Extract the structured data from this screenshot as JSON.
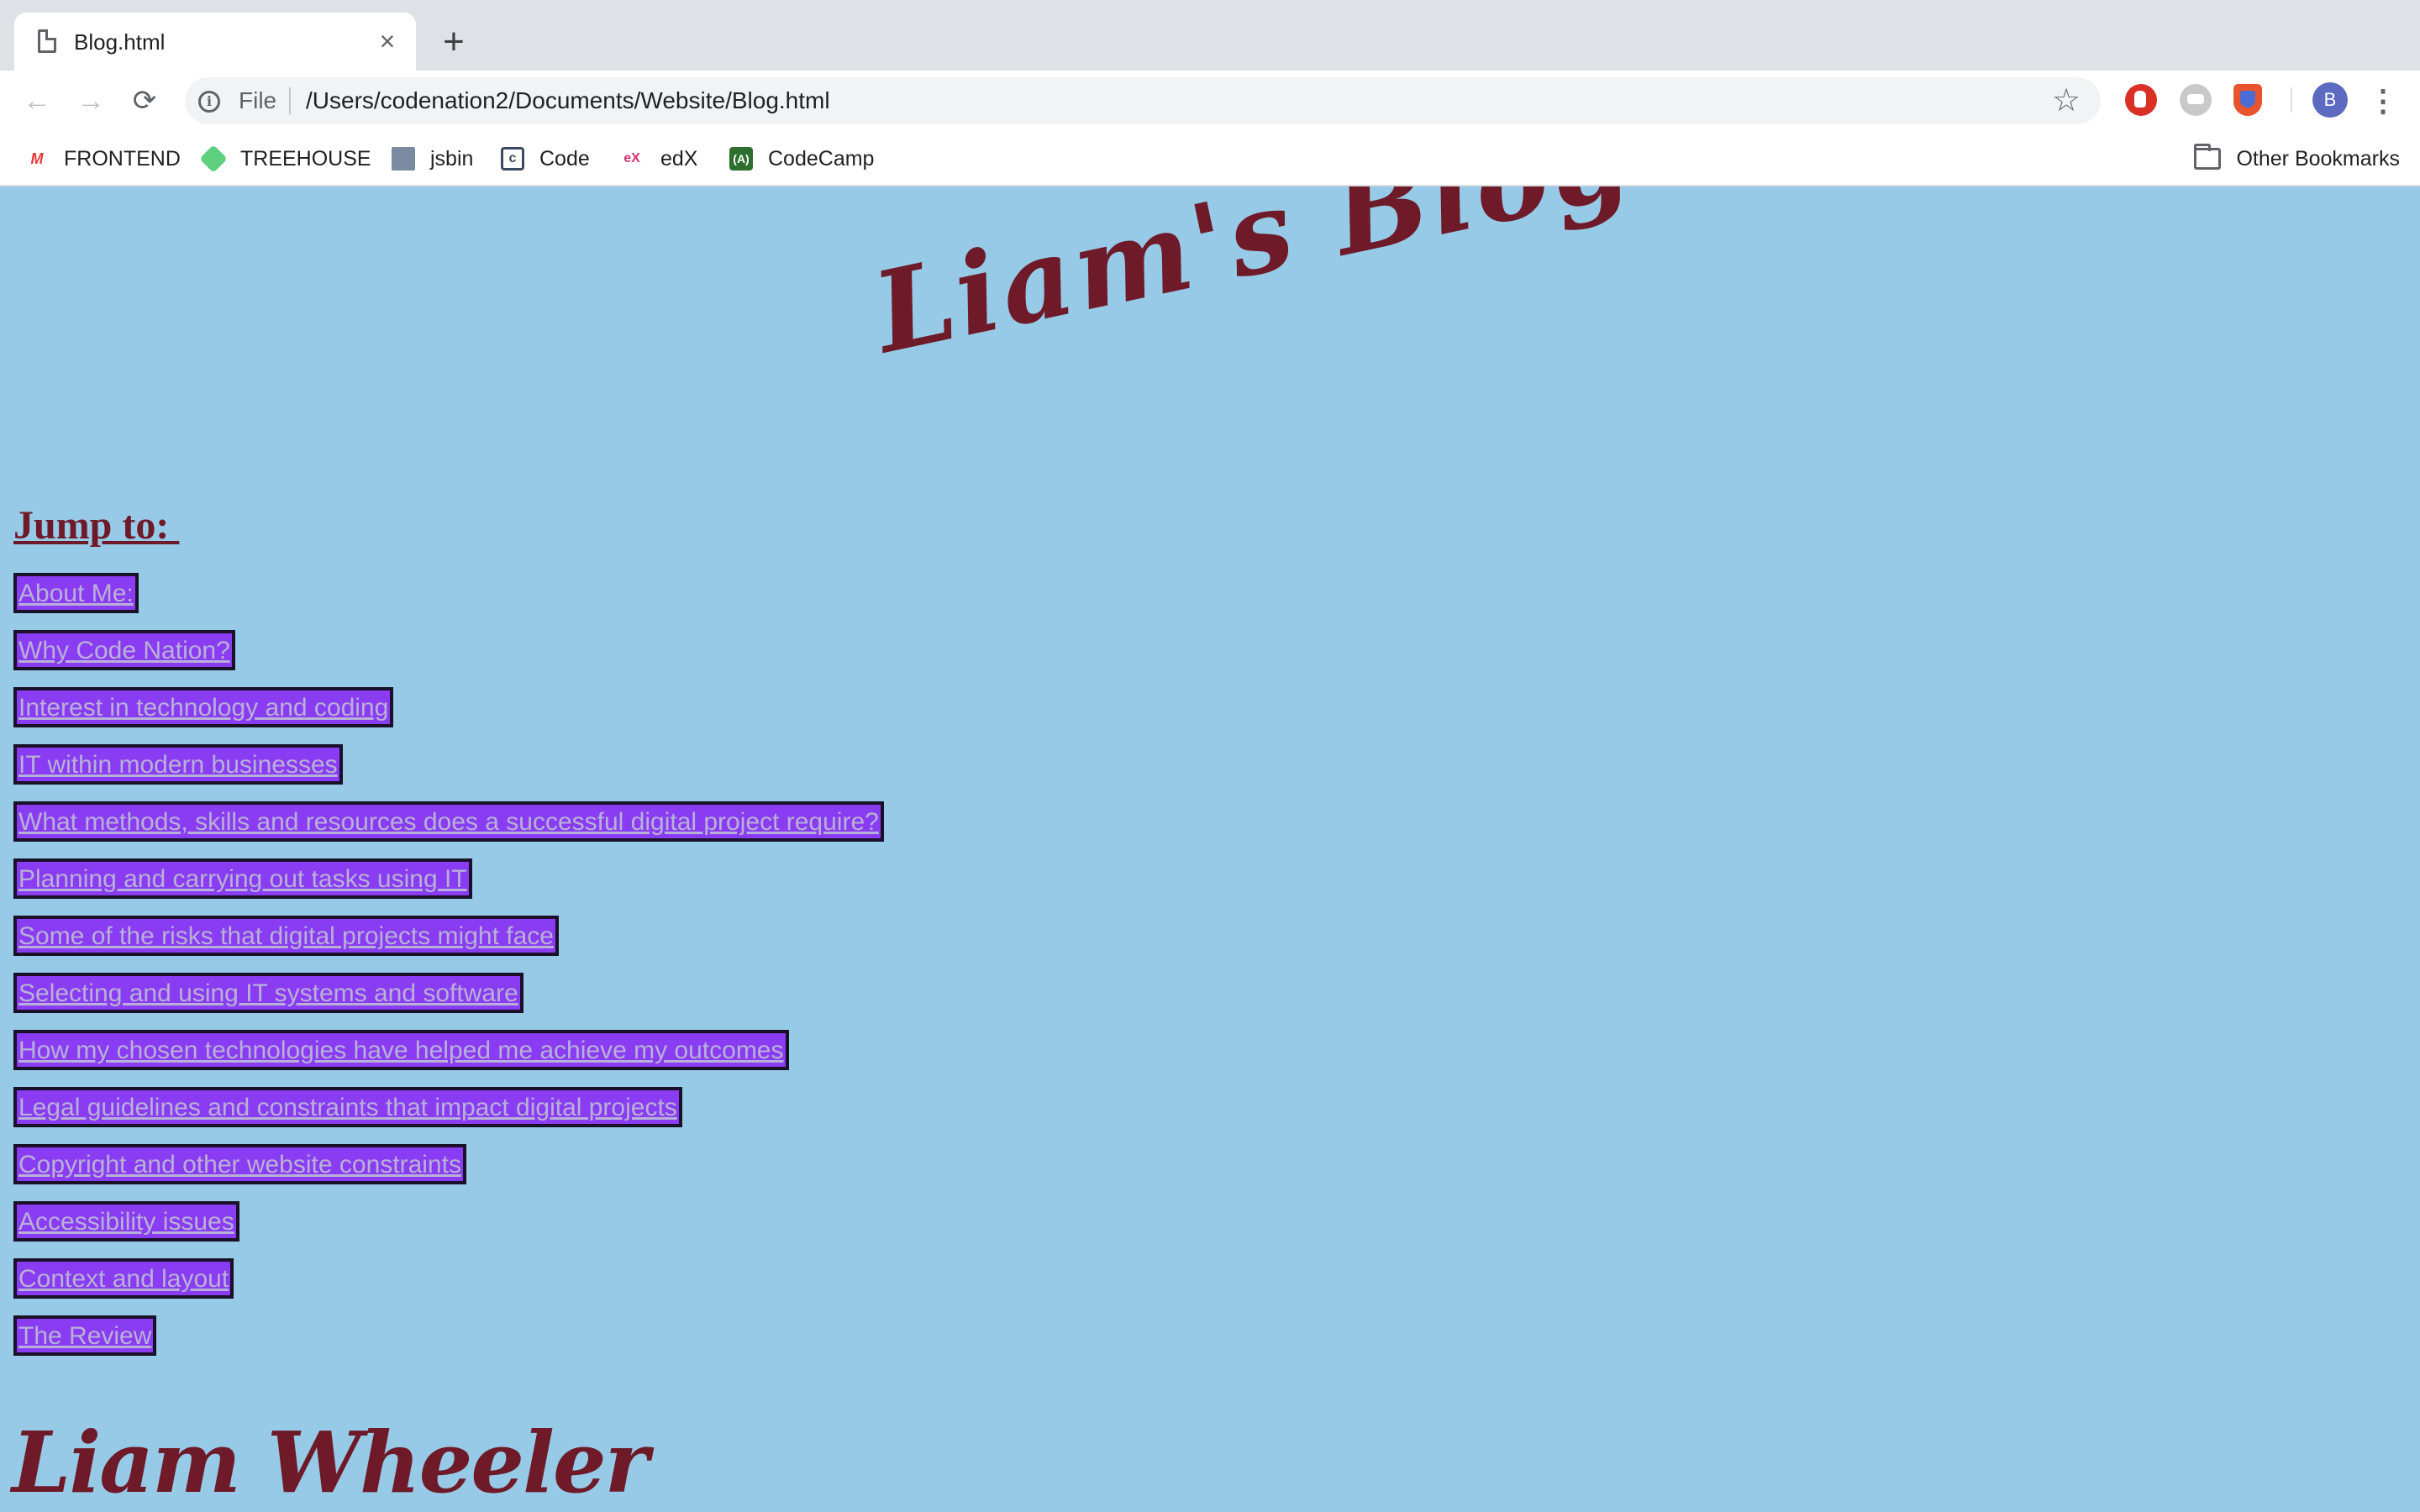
{
  "browser": {
    "tab": {
      "title": "Blog.html",
      "close_glyph": "×"
    },
    "new_tab_glyph": "+",
    "nav": {
      "back_glyph": "←",
      "forward_glyph": "→",
      "reload_glyph": "⟳"
    },
    "omnibox": {
      "scheme": "File",
      "url": "/Users/codenation2/Documents/Website/Blog.html",
      "star_glyph": "☆",
      "info_glyph": "i"
    },
    "profile_initial": "B",
    "menu_glyph": "⋮",
    "bookmarks": [
      {
        "label": "FRONTEND",
        "icon": "frontend-icon",
        "glyph": "M"
      },
      {
        "label": "TREEHOUSE",
        "icon": "treehouse-icon",
        "glyph": ""
      },
      {
        "label": "jsbin",
        "icon": "jsbin-icon",
        "glyph": ""
      },
      {
        "label": "Code",
        "icon": "code-icon",
        "glyph": "c"
      },
      {
        "label": "edX",
        "icon": "edx-icon",
        "glyph": "eX"
      },
      {
        "label": "CodeCamp",
        "icon": "codecamp-icon",
        "glyph": "(A)"
      }
    ],
    "other_bookmarks": "Other Bookmarks"
  },
  "page": {
    "background": "#96cae6",
    "accent_color": "#6f1a28",
    "link_background": "#8a3cf2",
    "title": "Liam's Blog",
    "jump_to": "Jump to: ",
    "links": [
      "About Me:",
      "Why Code Nation?",
      "Interest in technology and coding",
      "IT within modern businesses",
      "What methods, skills and resources does a successful digital project require?",
      "Planning and carrying out tasks using IT",
      "Some of the risks that digital projects might face",
      "Selecting and using IT systems and software",
      "How my chosen technologies have helped me achieve my outcomes",
      "Legal guidelines and constraints that impact digital projects",
      "Copyright and other website constraints",
      "Accessibility issues",
      "Context and layout",
      "The Review"
    ],
    "author": "Liam Wheeler"
  }
}
